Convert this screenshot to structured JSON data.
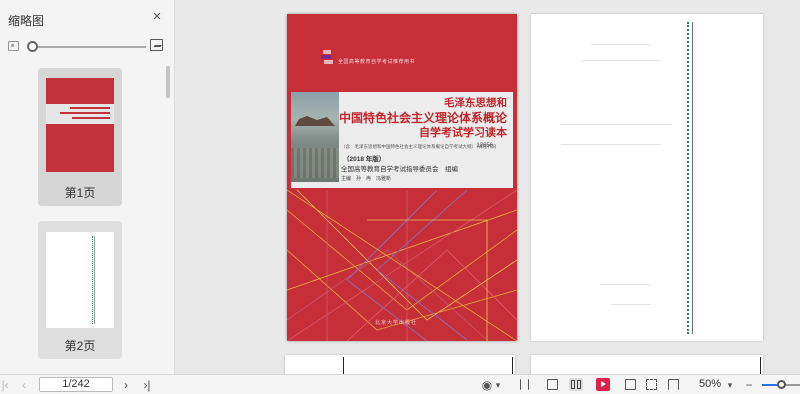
{
  "sidebar": {
    "title": "缩略图",
    "close_glyph": "×",
    "thumbnails": [
      {
        "label": "第1页"
      },
      {
        "label": "第2页"
      }
    ]
  },
  "cover": {
    "series": "全国高等教育自学考试推荐用书",
    "title_line1": "毛泽东思想和",
    "title_line2": "中国特色社会主义理论体系概论",
    "title_line3": "自学考试学习读本",
    "subtitle": "（含：毛泽东思想和中国特色社会主义理论体系概论自学考试大纲）（课程代码",
    "course_code": "12656",
    "year": "（2018 年版）",
    "organizer": "全国高等教育自学考试指导委员会　组编",
    "editors": "主编　孙　冉　冯雅新",
    "press": "北京大学出版社"
  },
  "toolbar": {
    "first_glyph": "|‹",
    "prev_glyph": "‹",
    "page_value": "1/242",
    "next_glyph": "›",
    "last_glyph": "›|",
    "eye_glyph": "◉",
    "dropdown_glyph": "▾",
    "zoom_value": "50%",
    "zoom_dropdown_glyph": "▾",
    "zoom_out_glyph": "−",
    "accent_color": "#d9234b"
  }
}
